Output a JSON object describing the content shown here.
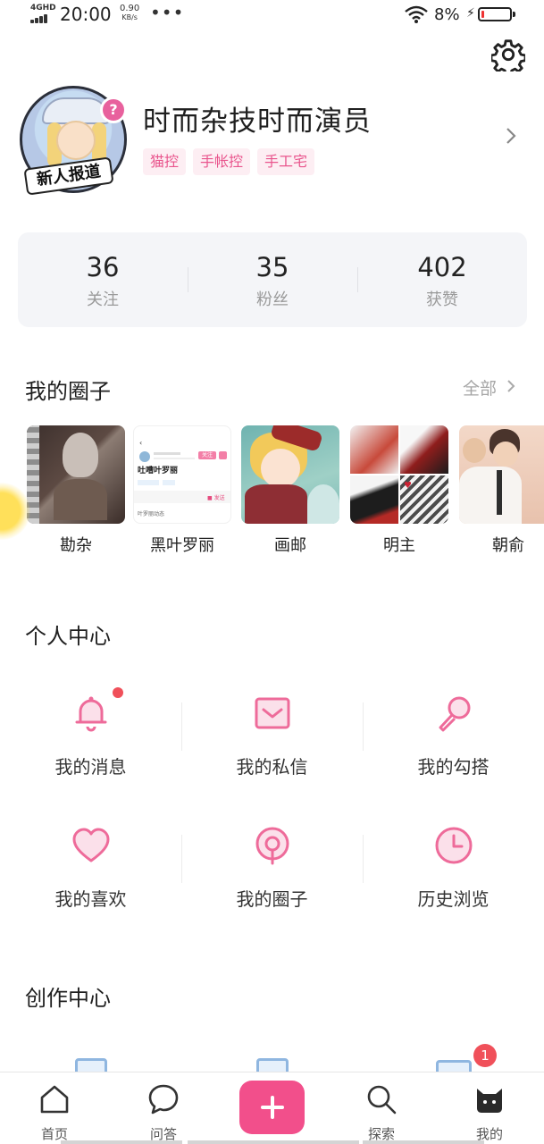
{
  "status_bar": {
    "network": "4GHD",
    "time": "20:00",
    "speed_value": "0.90",
    "speed_unit": "KB/s",
    "more": "•••",
    "battery": "8%"
  },
  "profile": {
    "avatar_badge": "?",
    "avatar_tag": "新人报道",
    "username": "时而杂技时而演员",
    "tags": [
      "猫控",
      "手帐控",
      "手工宅"
    ]
  },
  "stats": [
    {
      "value": "36",
      "label": "关注"
    },
    {
      "value": "35",
      "label": "粉丝"
    },
    {
      "value": "402",
      "label": "获赞"
    }
  ],
  "my_circles": {
    "title": "我的圈子",
    "see_all": "全部",
    "items": [
      {
        "name": "勘杂"
      },
      {
        "name": "黑叶罗丽",
        "thumb_title": "吐嘈叶罗丽",
        "thumb_button": "关注",
        "thumb_footer": "叶罗丽动态"
      },
      {
        "name": "画邮"
      },
      {
        "name": "明主"
      },
      {
        "name": "朝俞"
      }
    ]
  },
  "personal_center": {
    "title": "个人中心",
    "items": [
      {
        "label": "我的消息",
        "icon": "bell-icon"
      },
      {
        "label": "我的私信",
        "icon": "mail-icon"
      },
      {
        "label": "我的勾搭",
        "icon": "microphone-icon"
      },
      {
        "label": "我的喜欢",
        "icon": "heart-icon"
      },
      {
        "label": "我的圈子",
        "icon": "circle-pin-icon"
      },
      {
        "label": "历史浏览",
        "icon": "clock-icon"
      }
    ]
  },
  "creation_center": {
    "title": "创作中心",
    "badge": "1"
  },
  "tabbar": {
    "items": [
      {
        "label": "首页",
        "icon": "home-icon"
      },
      {
        "label": "问答",
        "icon": "chat-bubble-icon"
      },
      {
        "label": "",
        "icon": "plus-icon"
      },
      {
        "label": "探索",
        "icon": "search-icon"
      },
      {
        "label": "我的",
        "icon": "cat-icon"
      }
    ]
  },
  "colors": {
    "accent": "#f24f8b",
    "icon_pink": "#ee6b9a",
    "tag_bg": "#fdeef3",
    "badge_red": "#f0505a"
  }
}
